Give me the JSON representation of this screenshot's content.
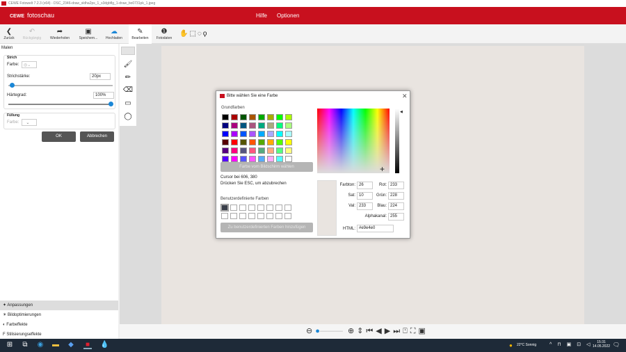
{
  "window": {
    "title": "CEWE Fotowelt 7.2.3 (x64) - DSC_2346-draw_sldha2ps_1_s3dgbflg_1-draw_bo0731pk_1.jpeg"
  },
  "header": {
    "brand_logo": "CEWE",
    "brand": "fotoschau",
    "nav": [
      "Hilfe",
      "Optionen"
    ]
  },
  "toolbar": {
    "items": [
      {
        "label": "Zurück",
        "icon": "chevron-left",
        "enabled": true
      },
      {
        "label": "Rückgängig",
        "icon": "undo",
        "enabled": false
      },
      {
        "label": "Wiederholen",
        "icon": "redo",
        "enabled": true
      },
      {
        "label": "Speichern...",
        "icon": "save",
        "enabled": true
      },
      {
        "label": "Hochladen",
        "icon": "cloud-upload",
        "enabled": true
      },
      {
        "label": "Bearbeiten",
        "icon": "edit",
        "enabled": true,
        "active": true
      },
      {
        "label": "Fotodaten",
        "icon": "info",
        "enabled": true
      }
    ],
    "selection_tools": [
      "hand",
      "rect-select",
      "ellipse-select",
      "lasso"
    ]
  },
  "paint_panel": {
    "title": "Malen",
    "stroke_group": "Strich",
    "color_label": "Farbe:",
    "width_label": "Strichstärke:",
    "width_value": "20px",
    "width_slider_fraction": 0.03,
    "hardness_label": "Härtegrad:",
    "hardness_value": "100%",
    "hardness_slider_fraction": 1.0,
    "fill_group": "Füllung",
    "fill_color_label": "Farbe:",
    "ok": "OK",
    "cancel": "Abbrechen"
  },
  "tools": [
    "brush",
    "pencil",
    "eraser",
    "rectangle",
    "ellipse"
  ],
  "bottom_panel": [
    {
      "label": "Anpassungen",
      "active": true
    },
    {
      "label": "Bildoptimierungen"
    },
    {
      "label": "Farbeffekte"
    },
    {
      "label": "Stilisierungseffekte"
    }
  ],
  "dialog": {
    "title": "Bitte wählen Sie eine Farbe",
    "basic_colors_label": "Grundfarben",
    "basic_colors": [
      "#000000",
      "#aa0000",
      "#005500",
      "#aa5500",
      "#00aa00",
      "#aaaa00",
      "#00ff00",
      "#aaff00",
      "#00007f",
      "#aa007f",
      "#00557f",
      "#aa557f",
      "#00aa7f",
      "#aaaa7f",
      "#00ff7f",
      "#aaff7f",
      "#0000ff",
      "#aa00ff",
      "#0055ff",
      "#aa55ff",
      "#00aaff",
      "#aaaaff",
      "#00ffff",
      "#aaffff",
      "#550000",
      "#ff0000",
      "#555500",
      "#ff5500",
      "#55aa00",
      "#ffaa00",
      "#55ff00",
      "#ffff00",
      "#55007f",
      "#ff007f",
      "#55557f",
      "#ff557f",
      "#55aa7f",
      "#ffaa7f",
      "#55ff7f",
      "#ffff7f",
      "#5500ff",
      "#ff00ff",
      "#5555ff",
      "#ff55ff",
      "#55aaff",
      "#ffaaff",
      "#55ffff",
      "#ffffff"
    ],
    "pick_screen": "Farbe vom Bildschirm wählen",
    "cursor_info": "Cursor bei 606, 380",
    "esc_info": "Drücken Sie ESC, um abzubrechen",
    "custom_colors_label": "Benutzerdefinierte Farben",
    "custom_first": "#3a3f4a",
    "add_custom": "Zu benutzerdefinierten Farben hinzufügen",
    "fields": {
      "hue_label": "Farbton:",
      "hue": "26",
      "sat_label": "Sat:",
      "sat": "10",
      "val_label": "Val:",
      "val": "233",
      "red_label": "Rot:",
      "red": "233",
      "green_label": "Grün:",
      "green": "228",
      "blue_label": "Blau:",
      "blue": "224",
      "alpha_label": "Alphakanal:",
      "alpha": "255",
      "html_label": "HTML:",
      "html": "#e9e4e0"
    }
  },
  "taskbar": {
    "weather": "22°C Sonnig",
    "time": "15:31",
    "date": "14.05.2022"
  },
  "colors": {
    "brand": "#c8101e",
    "accent": "#1b87d6",
    "canvas": "#e9e4e0"
  }
}
